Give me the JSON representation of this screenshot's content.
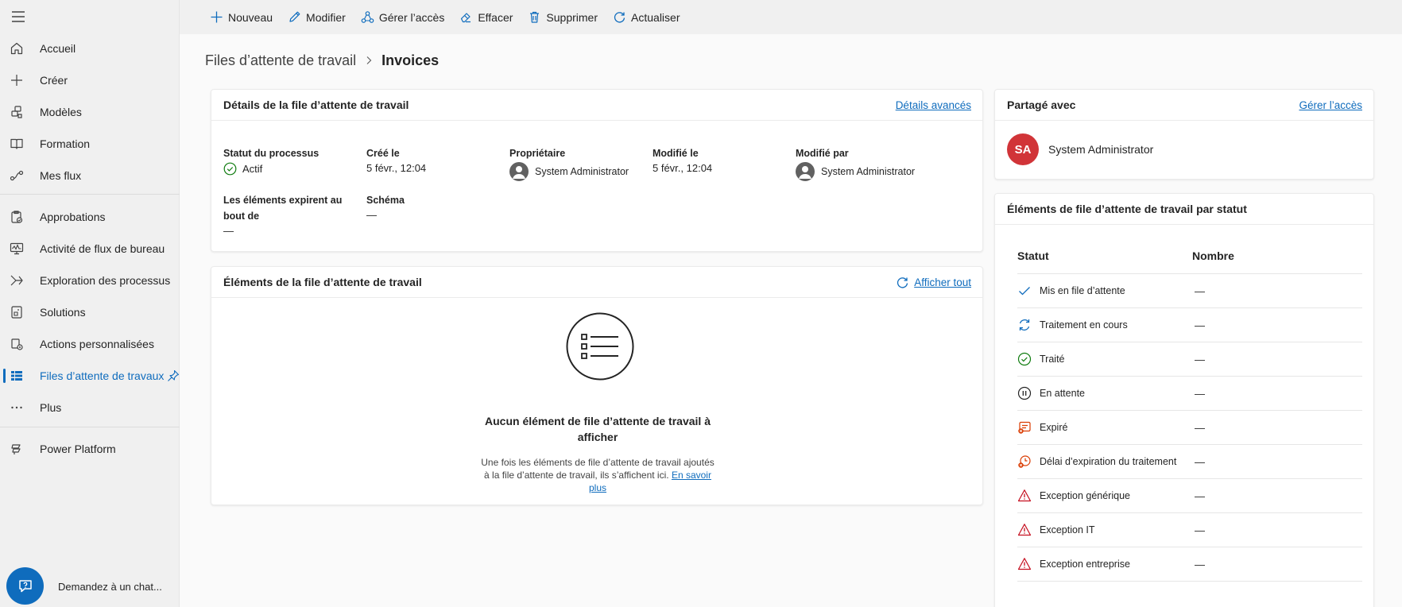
{
  "sidebar": {
    "items": [
      {
        "label": "Accueil",
        "icon": "home-icon"
      },
      {
        "label": "Créer",
        "icon": "plus-icon"
      },
      {
        "label": "Modèles",
        "icon": "templates-icon"
      },
      {
        "label": "Formation",
        "icon": "book-icon"
      },
      {
        "label": "Mes flux",
        "icon": "flow-icon"
      },
      {
        "label": "Approbations",
        "icon": "approvals-icon"
      },
      {
        "label": "Activité de flux de bureau",
        "icon": "monitor-icon"
      },
      {
        "label": "Exploration des processus",
        "icon": "process-mining-icon"
      },
      {
        "label": "Solutions",
        "icon": "solutions-icon"
      },
      {
        "label": "Actions personnalisées",
        "icon": "custom-actions-icon"
      },
      {
        "label": "Files d’attente de travaux",
        "icon": "table-icon"
      },
      {
        "label": "Plus",
        "icon": "more-icon"
      },
      {
        "label": "Power Platform",
        "icon": "power-platform-icon"
      }
    ],
    "chat_label": "Demandez à un chat..."
  },
  "toolbar": {
    "new_label": "Nouveau",
    "edit_label": "Modifier",
    "manage_access_label": "Gérer l’accès",
    "clear_label": "Effacer",
    "delete_label": "Supprimer",
    "refresh_label": "Actualiser"
  },
  "breadcrumb": {
    "parent": "Files d’attente de travail",
    "current": "Invoices"
  },
  "details": {
    "title": "Détails de la file d’attente de travail",
    "advanced_link": "Détails avancés",
    "status_label": "Statut du processus",
    "status_value": "Actif",
    "created_label": "Créé le",
    "created_value": "5 févr., 12:04",
    "owner_label": "Propriétaire",
    "owner_value": "System Administrator",
    "modified_label": "Modifié le",
    "modified_value": "5 févr., 12:04",
    "modified_by_label": "Modifié par",
    "modified_by_value": "System Administrator",
    "expire_label_1": "Les éléments expirent au",
    "expire_label_2": "bout de",
    "expire_value": "—",
    "schema_label": "Schéma",
    "schema_value": "—"
  },
  "items": {
    "title": "Éléments de la file d’attente de travail",
    "show_all": "Afficher tout",
    "empty_title_1": "Aucun élément de file d’attente de travail à",
    "empty_title_2": "afficher",
    "empty_desc_1": "Une fois les éléments de file d’attente de travail ajoutés",
    "empty_desc_2": "à la file d’attente de travail, ils s’affichent ici.",
    "learn_more_1": "En savoir",
    "learn_more_2": "plus"
  },
  "shared": {
    "title": "Partagé avec",
    "manage_link": "Gérer l’accès",
    "initials": "SA",
    "user": "System Administrator",
    "avatar_color": "#d13438"
  },
  "status": {
    "title": "Éléments de file d’attente de travail par statut",
    "col_status": "Statut",
    "col_count": "Nombre",
    "rows": [
      {
        "label": "Mis en file d’attente",
        "count": "—",
        "icon": "check-icon"
      },
      {
        "label": "Traitement en cours",
        "count": "—",
        "icon": "processing-icon"
      },
      {
        "label": "Traité",
        "count": "—",
        "icon": "check-circle-icon"
      },
      {
        "label": "En attente",
        "count": "—",
        "icon": "pause-icon"
      },
      {
        "label": "Expiré",
        "count": "—",
        "icon": "expired-icon"
      },
      {
        "label": "Délai d’expiration du traitement",
        "count": "—",
        "icon": "timeout-icon"
      },
      {
        "label": "Exception générique",
        "count": "—",
        "icon": "warning-icon"
      },
      {
        "label": "Exception IT",
        "count": "—",
        "icon": "warning-icon"
      },
      {
        "label": "Exception entreprise",
        "count": "—",
        "icon": "warning-icon"
      }
    ]
  },
  "colors": {
    "accent": "#0f6cbd",
    "success": "#107c10",
    "danger": "#c50f1f",
    "orange": "#da3b01"
  }
}
